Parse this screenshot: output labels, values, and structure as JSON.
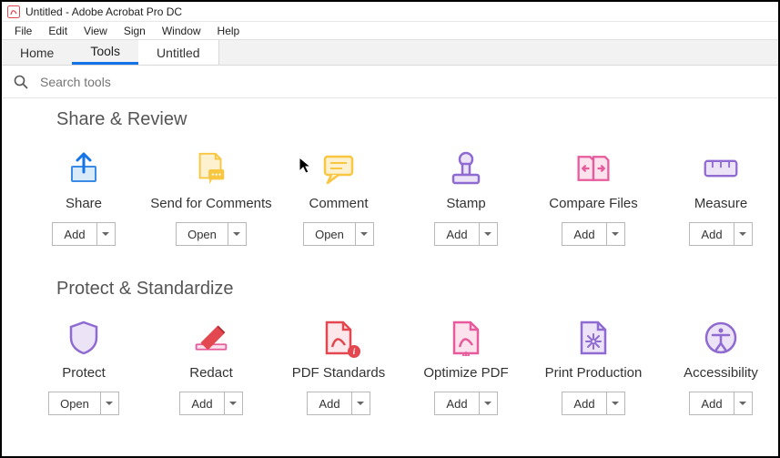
{
  "window": {
    "title": "Untitled - Adobe Acrobat Pro DC"
  },
  "menubar": [
    "File",
    "Edit",
    "View",
    "Sign",
    "Window",
    "Help"
  ],
  "tabs": {
    "items": [
      "Home",
      "Tools",
      "Untitled"
    ],
    "active": 1
  },
  "search": {
    "placeholder": "Search tools"
  },
  "sections": [
    {
      "title": "Share & Review",
      "tools": [
        {
          "icon": "share-icon",
          "label": "Share",
          "action": "Add"
        },
        {
          "icon": "send-comments-icon",
          "label": "Send for Comments",
          "action": "Open"
        },
        {
          "icon": "comment-icon",
          "label": "Comment",
          "action": "Open"
        },
        {
          "icon": "stamp-icon",
          "label": "Stamp",
          "action": "Add"
        },
        {
          "icon": "compare-icon",
          "label": "Compare Files",
          "action": "Add"
        },
        {
          "icon": "measure-icon",
          "label": "Measure",
          "action": "Add"
        }
      ]
    },
    {
      "title": "Protect & Standardize",
      "tools": [
        {
          "icon": "protect-icon",
          "label": "Protect",
          "action": "Open"
        },
        {
          "icon": "redact-icon",
          "label": "Redact",
          "action": "Add"
        },
        {
          "icon": "pdf-standards-icon",
          "label": "PDF Standards",
          "action": "Add",
          "badge": true
        },
        {
          "icon": "optimize-icon",
          "label": "Optimize PDF",
          "action": "Add"
        },
        {
          "icon": "print-prod-icon",
          "label": "Print Production",
          "action": "Add"
        },
        {
          "icon": "accessibility-icon",
          "label": "Accessibility",
          "action": "Add"
        }
      ]
    }
  ],
  "colors": {
    "blue": "#3b8be6",
    "yellow": "#f9c642",
    "purple": "#8e6ad1",
    "magenta": "#e75a9c",
    "red": "#e34850"
  }
}
